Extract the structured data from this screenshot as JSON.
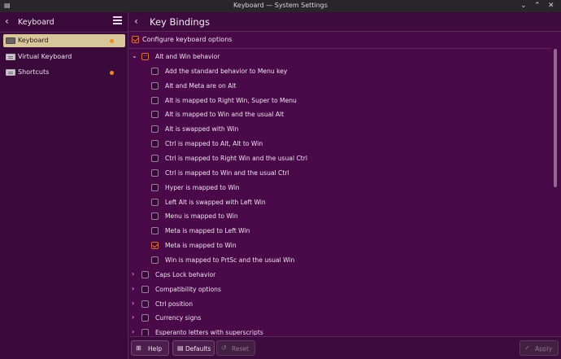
{
  "window": {
    "title": "Keyboard — System Settings",
    "app_icon": "kde-app-icon",
    "controls": [
      "minimize",
      "maximize",
      "close"
    ]
  },
  "sidebar": {
    "title": "Keyboard",
    "items": [
      {
        "label": "Keyboard",
        "icon": "keyboard-icon",
        "active": true,
        "dot": true
      },
      {
        "label": "Virtual Keyboard",
        "icon": "keyboard-icon",
        "active": false,
        "dot": false
      },
      {
        "label": "Shortcuts",
        "icon": "keyboard-icon",
        "active": false,
        "dot": true
      }
    ]
  },
  "main": {
    "title": "Key Bindings",
    "configure_label": "Configure keyboard options",
    "configure_checked": true,
    "group": {
      "label": "Alt and Win behavior",
      "expanded": true,
      "state": "partial",
      "options": [
        {
          "label": "Add the standard behavior to Menu key",
          "checked": false
        },
        {
          "label": "Alt and Meta are on Alt",
          "checked": false
        },
        {
          "label": "Alt is mapped to Right Win, Super to Menu",
          "checked": false
        },
        {
          "label": "Alt is mapped to Win and the usual Alt",
          "checked": false
        },
        {
          "label": "Alt is swapped with Win",
          "checked": false
        },
        {
          "label": "Ctrl is mapped to Alt, Alt to Win",
          "checked": false
        },
        {
          "label": "Ctrl is mapped to Right Win and the usual Ctrl",
          "checked": false
        },
        {
          "label": "Ctrl is mapped to Win and the usual Ctrl",
          "checked": false
        },
        {
          "label": "Hyper is mapped to Win",
          "checked": false
        },
        {
          "label": "Left Alt is swapped with Left Win",
          "checked": false
        },
        {
          "label": "Menu is mapped to Win",
          "checked": false
        },
        {
          "label": "Meta is mapped to Left Win",
          "checked": false
        },
        {
          "label": "Meta is mapped to Win",
          "checked": true
        },
        {
          "label": "Win is mapped to PrtSc and the usual Win",
          "checked": false
        }
      ]
    },
    "collapsed_groups": [
      {
        "label": "Caps Lock behavior"
      },
      {
        "label": "Compatibility options"
      },
      {
        "label": "Ctrl position"
      },
      {
        "label": "Currency signs"
      },
      {
        "label": "Esperanto letters with superscripts"
      }
    ]
  },
  "buttons": {
    "help": "Help",
    "defaults": "Defaults",
    "reset": "Reset",
    "apply": "Apply"
  },
  "colors": {
    "background": "#4a0a4a",
    "sidebar_active": "#d8c79a",
    "accent": "#e26a3a",
    "notification_dot": "#f08a1e"
  }
}
